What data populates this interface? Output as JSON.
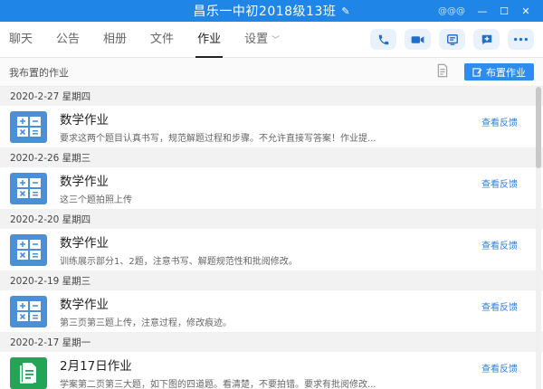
{
  "window": {
    "title": "昌乐一中初2018级13班",
    "user": "@@@"
  },
  "tabs": [
    {
      "label": "聊天"
    },
    {
      "label": "公告"
    },
    {
      "label": "相册"
    },
    {
      "label": "文件"
    },
    {
      "label": "作业",
      "active": true
    },
    {
      "label": "设置"
    }
  ],
  "actions": [
    "phone-icon",
    "video-icon",
    "screen-share-icon",
    "message-plus-icon",
    "more-icon"
  ],
  "subheader": {
    "label": "我布置的作业",
    "publish_label": "布置作业"
  },
  "homework": [
    {
      "date": "2020-2-27 星期四",
      "title": "数学作业",
      "desc": "要求这两个题目认真书写，规范解题过程和步骤。不允许直接写答案！作业提...",
      "feedback": "查看反馈",
      "icon": "calculator-icon"
    },
    {
      "date": "2020-2-26 星期三",
      "title": "数学作业",
      "desc": "这三个题拍照上传",
      "feedback": "查看反馈",
      "icon": "calculator-icon"
    },
    {
      "date": "2020-2-20 星期四",
      "title": "数学作业",
      "desc": "训练展示部分1、2题，注意书写、解题规范性和批阅修改。",
      "feedback": "查看反馈",
      "icon": "calculator-icon"
    },
    {
      "date": "2020-2-19 星期三",
      "title": "数学作业",
      "desc": "第三页第三题上传，注意过程，修改痕迹。",
      "feedback": "查看反馈",
      "icon": "calculator-icon"
    },
    {
      "date": "2020-2-17 星期一",
      "title": "2月17日作业",
      "desc": "学案第二页第三大题，如下图的四道题。看清楚，不要拍错。要求有批阅修改...",
      "feedback": "查看反馈",
      "icon": "document-icon"
    }
  ],
  "colors": {
    "titlebar": "#1f86e8",
    "accent": "#2d8cf0",
    "calc_icon": "#4a90d9",
    "doc_icon": "#23a457"
  }
}
